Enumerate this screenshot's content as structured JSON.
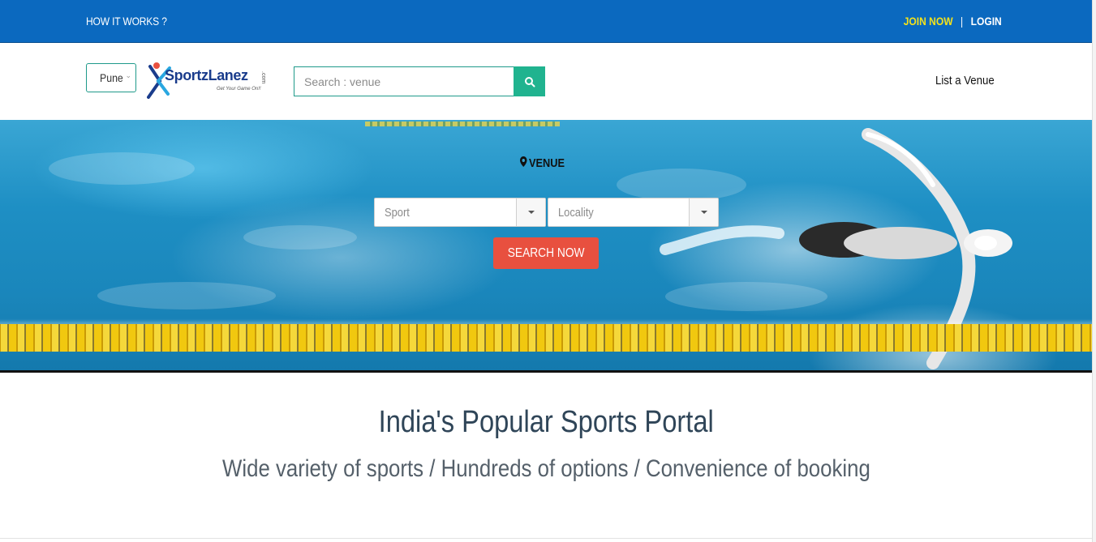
{
  "topbar": {
    "how_it_works": "HOW IT WORKS ?",
    "join_now": "JOIN NOW",
    "separator": "|",
    "login": "LOGIN",
    "colors": {
      "background": "#0b69bf",
      "join": "#f4e21b"
    }
  },
  "header": {
    "city_select": {
      "value": "Pune"
    },
    "logo": {
      "brand": "SportzLanez",
      "tagline": "Get Your Game On!!",
      "suffix": ".com"
    },
    "search": {
      "placeholder": "Search : venue",
      "icon": "search-icon"
    },
    "list_venue": "List a Venue"
  },
  "hero": {
    "venue_label": "VENUE",
    "sport_select": {
      "value": "Sport"
    },
    "locality_select": {
      "value": "Locality"
    },
    "search_button": "SEARCH NOW",
    "colors": {
      "search_button": "#e8503f"
    }
  },
  "main": {
    "headline": "India's Popular Sports Portal",
    "subline": "Wide variety of sports / Hundreds of options / Convenience of booking"
  }
}
